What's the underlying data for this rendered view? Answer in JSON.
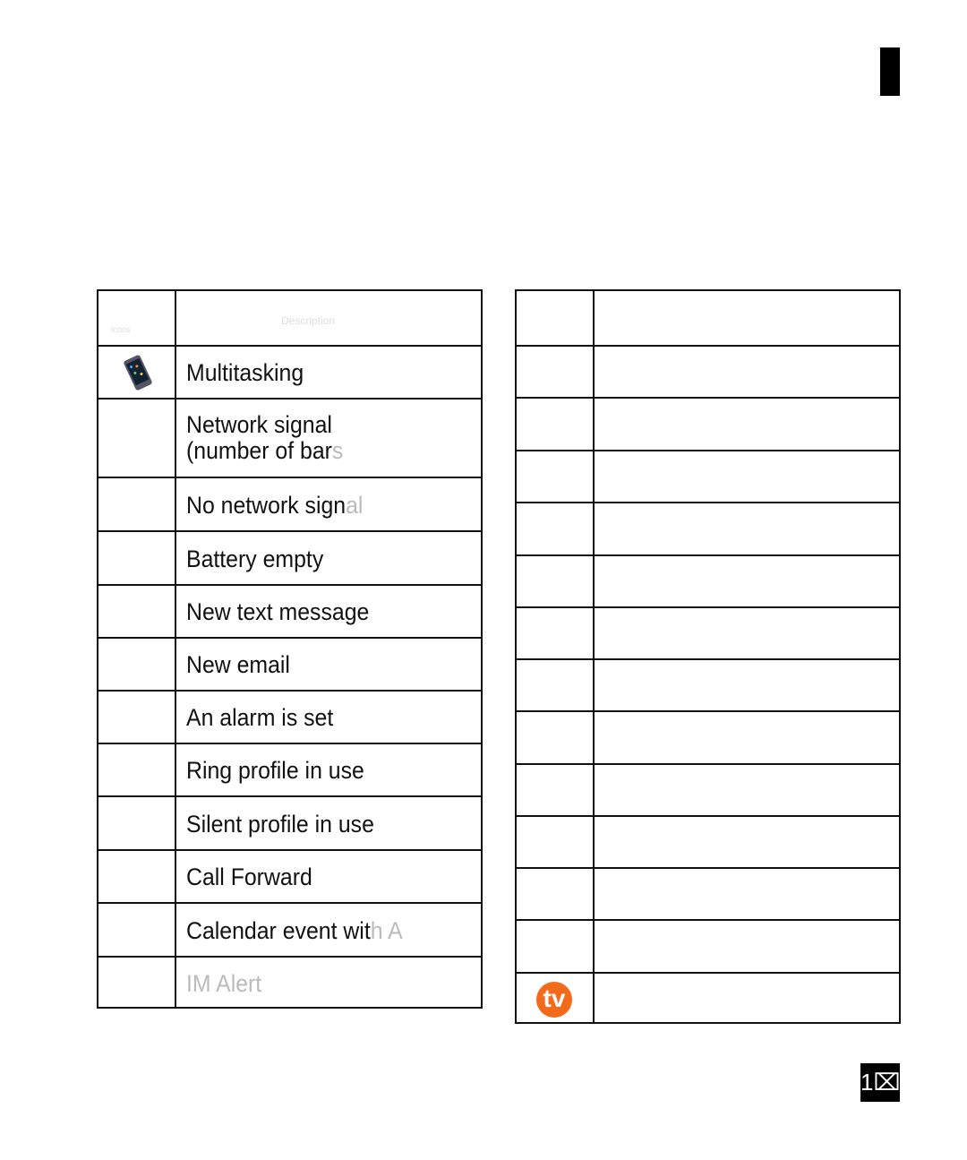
{
  "left_table": {
    "header": {
      "col1": "Icons",
      "col2": "Description"
    },
    "rows": [
      {
        "icon": "multitasking-phone-icon",
        "text": "Multitasking",
        "faded": ""
      },
      {
        "icon": "",
        "text": "Network signal",
        "faded": "",
        "text2": "(number of bar",
        "faded2": "s"
      },
      {
        "icon": "",
        "text": "No network sign",
        "faded": "al"
      },
      {
        "icon": "",
        "text": "Battery empty",
        "faded": ""
      },
      {
        "icon": "",
        "text": "New text message",
        "faded": ""
      },
      {
        "icon": "",
        "text": "New email",
        "faded": ""
      },
      {
        "icon": "",
        "text": "An alarm is set",
        "faded": ""
      },
      {
        "icon": "",
        "text": "Ring profile in use",
        "faded": ""
      },
      {
        "icon": "",
        "text": "Silent profile in use",
        "faded": ""
      },
      {
        "icon": "",
        "text": "Call Forward",
        "faded": ""
      },
      {
        "icon": "",
        "text": "Calendar event wit",
        "faded": "h A"
      },
      {
        "icon": "",
        "text": "",
        "faded": "IM Alert"
      }
    ]
  },
  "right_table": {
    "last_row_icon": "tv-icon",
    "tv_label": "tv",
    "accent": "#f26a1b"
  },
  "page_number": "1⌧"
}
